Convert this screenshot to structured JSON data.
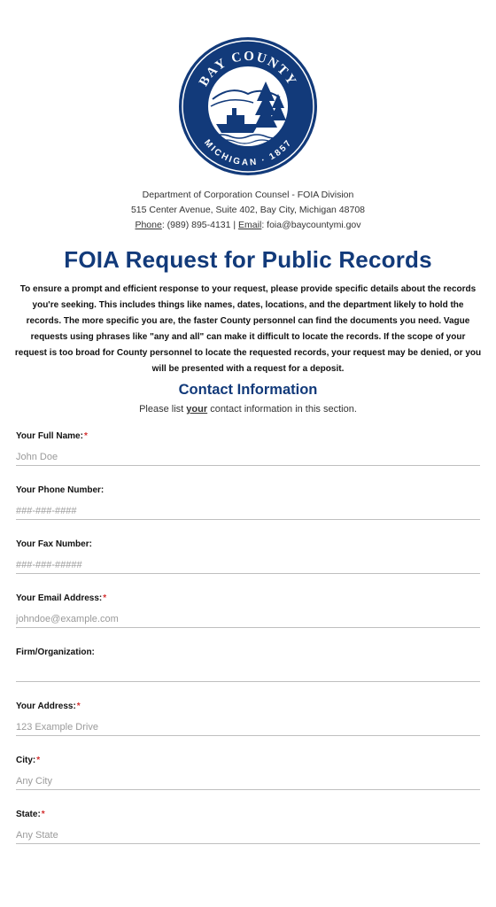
{
  "header": {
    "seal_text_top": "BAY COUNTY",
    "seal_text_bottom": "MICHIGAN · 1857",
    "department": "Department of Corporation Counsel - FOIA Division",
    "address": "515 Center Avenue, Suite 402, Bay City, Michigan 48708",
    "phone_label": "Phone",
    "phone_value": ": (989) 895-4131 | ",
    "email_label": "Email",
    "email_value": ": foia@baycountymi.gov"
  },
  "form": {
    "title": "FOIA Request for Public Records",
    "intro": "To ensure a prompt and efficient response to your request, please provide specific details about the records you're seeking. This includes things like names, dates, locations, and the department likely to hold the records. The more specific you are, the faster County personnel can find the documents you need. Vague requests using phrases like \"any and all\" can make it difficult to locate the records. If the scope of your request is too broad for County personnel to locate the requested records, your request may be denied, or you will be presented with a request for a deposit."
  },
  "contact": {
    "title": "Contact Information",
    "sub_before": "Please list ",
    "sub_emph": "your",
    "sub_after": " contact information in this section."
  },
  "fields": {
    "full_name": {
      "label": "Your Full Name:",
      "required": "*",
      "placeholder": "John Doe"
    },
    "phone": {
      "label": "Your Phone Number:",
      "placeholder": "###-###-####"
    },
    "fax": {
      "label": "Your Fax Number:",
      "placeholder": "###-###-#####"
    },
    "email": {
      "label": "Your Email Address:",
      "required": "*",
      "placeholder": "johndoe@example.com"
    },
    "firm": {
      "label": "Firm/Organization:",
      "placeholder": ""
    },
    "address": {
      "label": "Your Address:",
      "required": "*",
      "placeholder": "123 Example Drive"
    },
    "city": {
      "label": "City:",
      "required": "*",
      "placeholder": "Any City"
    },
    "state": {
      "label": "State:",
      "required": "*",
      "placeholder": "Any State"
    }
  },
  "colors": {
    "brand_blue": "#123a7a",
    "required_red": "#d32f2f"
  }
}
